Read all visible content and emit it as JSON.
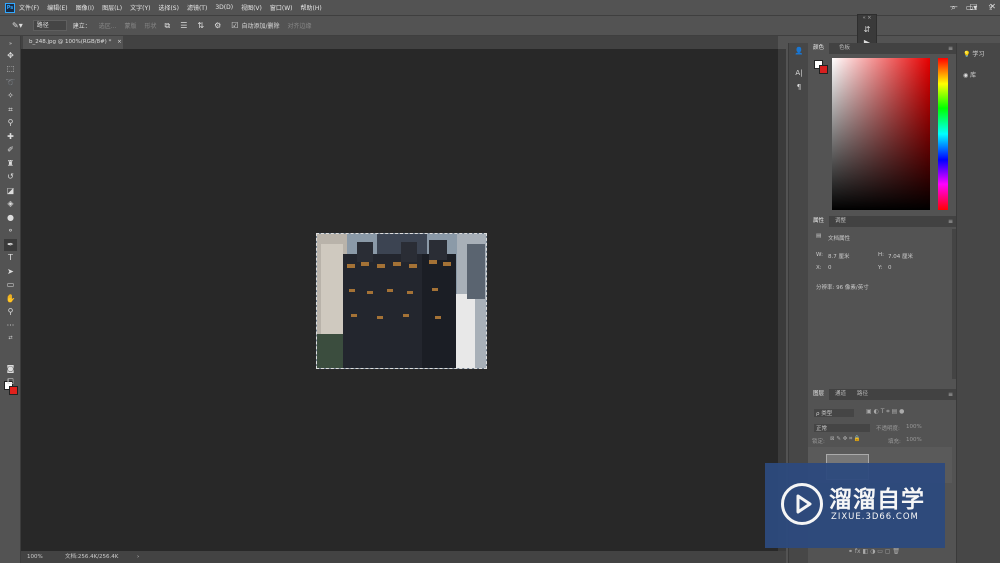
{
  "menu": {
    "items": [
      "文件(F)",
      "编辑(E)",
      "图像(I)",
      "图层(L)",
      "文字(Y)",
      "选择(S)",
      "滤镜(T)",
      "3D(D)",
      "视图(V)",
      "窗口(W)",
      "帮助(H)"
    ]
  },
  "options": {
    "tool_mode": "路径",
    "build_label": "建立：",
    "selection_btn": "选区...",
    "mask_btn": "蒙版",
    "shape_btn": "形状",
    "auto_add_label": "自动添加/删除",
    "align_edges_label": "对齐边缘"
  },
  "document": {
    "tab_title": "b_248.jpg @ 100%(RGB/8#) *",
    "close": "×"
  },
  "status": {
    "zoom": "100%",
    "doc_info": "文档:256.4K/256.4K",
    "arrow": "›"
  },
  "panels": {
    "color_tabs": [
      "颜色",
      "色板"
    ],
    "properties_tabs": [
      "属性",
      "调整"
    ],
    "doc_props_label": "文档属性",
    "w_label": "W:",
    "w_value": "8.7 厘米",
    "h_label": "H:",
    "h_value": "7.04 厘米",
    "x_label": "X:",
    "x_value": "0",
    "y_label": "Y:",
    "y_value": "0",
    "resolution": "分辨率: 96 像素/英寸",
    "layers_tabs": [
      "图层",
      "通道",
      "路径"
    ],
    "kind_label": "ρ 类型",
    "blend_mode": "正常",
    "opacity_label": "不透明度:",
    "opacity_value": "100%",
    "lock_label": "锁定:",
    "fill_label": "填充:",
    "fill_value": "100%"
  },
  "right_strip": {
    "learn": "学习",
    "library": "库"
  },
  "watermark": {
    "title": "溜溜自学",
    "subtitle": "ZIXUE.3D66.COM"
  },
  "colors": {
    "foreground": "#ffffff",
    "background": "#e0211c",
    "accent": "#31a8ff"
  }
}
